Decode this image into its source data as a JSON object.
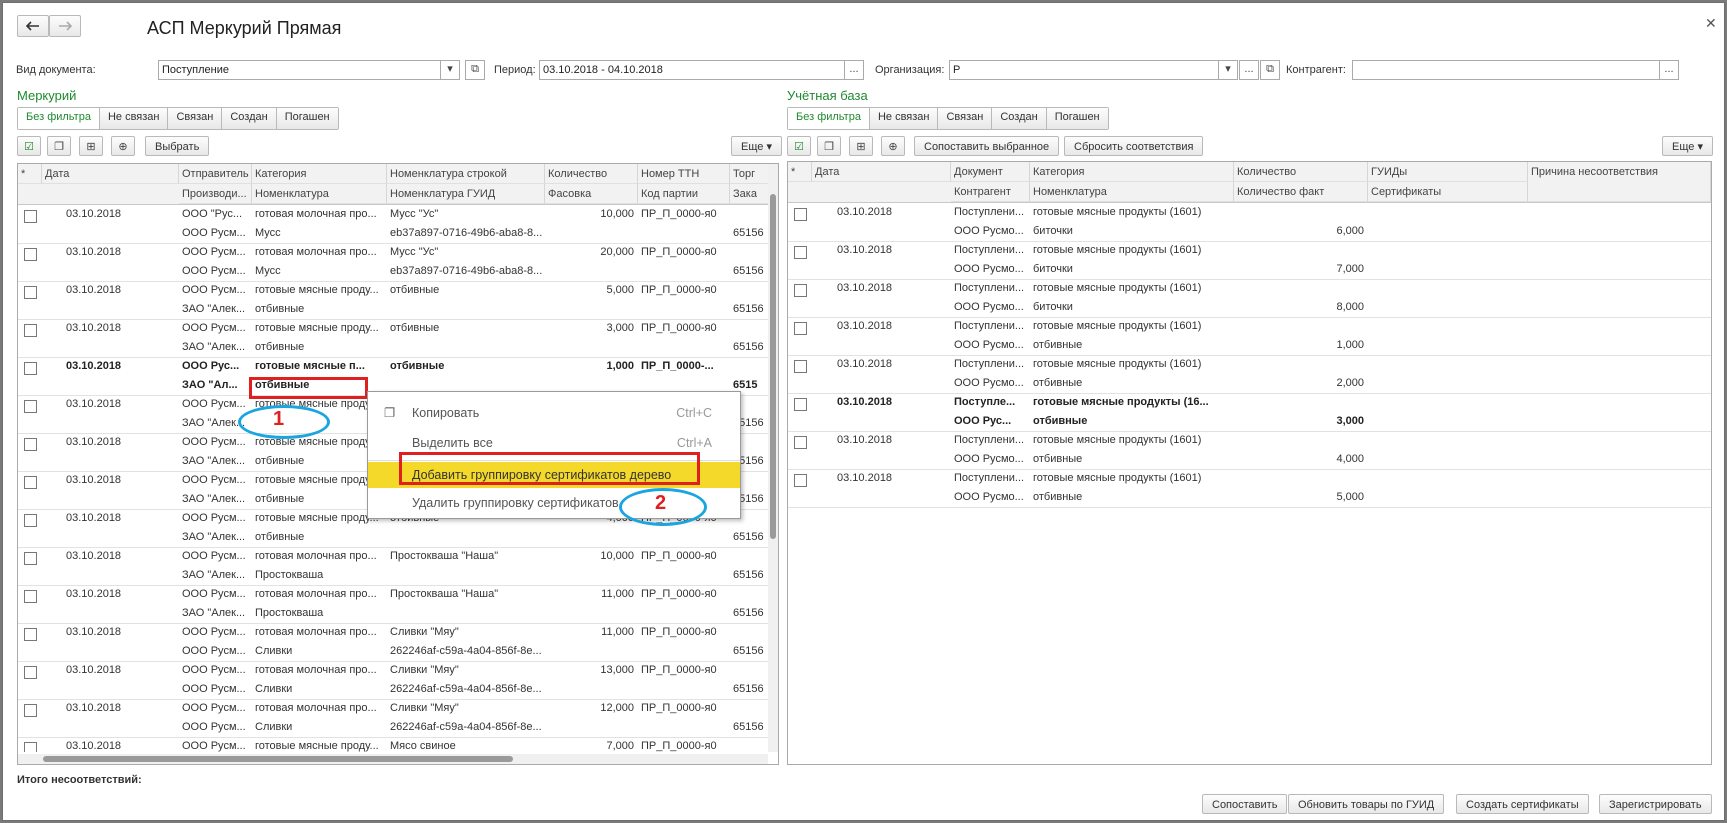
{
  "window": {
    "title": "АСП Меркурий Прямая"
  },
  "filters": {
    "doc_type_label": "Вид документа:",
    "doc_type_value": "Поступление",
    "period_label": "Период:",
    "period_value": "03.10.2018 - 04.10.2018",
    "org_label": "Организация:",
    "org_value": "Р",
    "contractor_label": "Контрагент:",
    "contractor_value": ""
  },
  "left": {
    "title": "Меркурий",
    "tabs": [
      "Без фильтра",
      "Не связан",
      "Связан",
      "Создан",
      "Погашен"
    ],
    "select_button": "Выбрать",
    "more_button": "Еще",
    "headers_top": [
      "Дата",
      "Отправитель",
      "Категория",
      "Номенклатура строкой",
      "Количество",
      "Номер ТТН",
      "Торг"
    ],
    "headers_bottom": [
      "Производи...",
      "Номенклатура",
      "Номенклатура ГУИД",
      "Фасовка",
      "Код партии",
      "Зака"
    ],
    "rows": [
      {
        "date": "03.10.2018",
        "sender": "ООО \"Рус...",
        "cat": "готовая молочная про...",
        "nom_str": "Мусс \"Ус\"",
        "qty": "10,000",
        "ttn": "ПР_П_0000-я0",
        "trade": "",
        "prod": "ООО Русм...",
        "nom": "Мусс",
        "guid": "eb37a897-0716-49b6-aba8-8...",
        "fas": "",
        "lot": "",
        "order": "65156"
      },
      {
        "date": "03.10.2018",
        "sender": "ООО Русм...",
        "cat": "готовая молочная про...",
        "nom_str": "Мусс \"Ус\"",
        "qty": "20,000",
        "ttn": "ПР_П_0000-я0",
        "trade": "",
        "prod": "ООО Русм...",
        "nom": "Мусс",
        "guid": "eb37a897-0716-49b6-aba8-8...",
        "fas": "",
        "lot": "",
        "order": "65156"
      },
      {
        "date": "03.10.2018",
        "sender": "ООО Русм...",
        "cat": "готовые мясные проду...",
        "nom_str": "отбивные",
        "qty": "5,000",
        "ttn": "ПР_П_0000-я0",
        "trade": "",
        "prod": "ЗАО \"Алек...",
        "nom": "отбивные",
        "guid": "",
        "fas": "",
        "lot": "",
        "order": "65156"
      },
      {
        "date": "03.10.2018",
        "sender": "ООО Русм...",
        "cat": "готовые мясные проду...",
        "nom_str": "отбивные",
        "qty": "3,000",
        "ttn": "ПР_П_0000-я0",
        "trade": "",
        "prod": "ЗАО \"Алек...",
        "nom": "отбивные",
        "guid": "",
        "fas": "",
        "lot": "",
        "order": "65156"
      },
      {
        "date": "03.10.2018",
        "sender": "ООО Рус...",
        "cat": "готовые мясные п...",
        "nom_str": "отбивные",
        "qty": "1,000",
        "ttn": "ПР_П_0000-...",
        "trade": "",
        "prod": "ЗАО \"Ал...",
        "nom": "отбивные",
        "guid": "",
        "fas": "",
        "lot": "",
        "order": "6515",
        "bold": true
      },
      {
        "date": "03.10.2018",
        "sender": "ООО Русм...",
        "cat": "готовые мясные проду...",
        "nom_str": "",
        "qty": "",
        "ttn": "",
        "trade": "",
        "prod": "ЗАО \"Алек...",
        "nom": "",
        "guid": "",
        "fas": "",
        "lot": "",
        "order": "65156"
      },
      {
        "date": "03.10.2018",
        "sender": "ООО Русм...",
        "cat": "готовые мясные проду...",
        "nom_str": "",
        "qty": "",
        "ttn": "",
        "trade": "",
        "prod": "ЗАО \"Алек...",
        "nom": "отбивные",
        "guid": "",
        "fas": "",
        "lot": "",
        "order": "65156"
      },
      {
        "date": "03.10.2018",
        "sender": "ООО Русм...",
        "cat": "готовые мясные проду...",
        "nom_str": "",
        "qty": "",
        "ttn": "",
        "trade": "",
        "prod": "ЗАО \"Алек...",
        "nom": "отбивные",
        "guid": "",
        "fas": "",
        "lot": "",
        "order": "65156"
      },
      {
        "date": "03.10.2018",
        "sender": "ООО Русм...",
        "cat": "готовые мясные проду...",
        "nom_str": "отбивные",
        "qty": "4,000",
        "ttn": "ПР_П_0000-я0",
        "trade": "",
        "prod": "ЗАО \"Алек...",
        "nom": "отбивные",
        "guid": "",
        "fas": "",
        "lot": "",
        "order": "65156"
      },
      {
        "date": "03.10.2018",
        "sender": "ООО Русм...",
        "cat": "готовая молочная про...",
        "nom_str": "Простокваша \"Наша\"",
        "qty": "10,000",
        "ttn": "ПР_П_0000-я0",
        "trade": "",
        "prod": "ЗАО \"Алек...",
        "nom": "Простокваша",
        "guid": "",
        "fas": "",
        "lot": "",
        "order": "65156"
      },
      {
        "date": "03.10.2018",
        "sender": "ООО Русм...",
        "cat": "готовая молочная про...",
        "nom_str": "Простокваша \"Наша\"",
        "qty": "11,000",
        "ttn": "ПР_П_0000-я0",
        "trade": "",
        "prod": "ЗАО \"Алек...",
        "nom": "Простокваша",
        "guid": "",
        "fas": "",
        "lot": "",
        "order": "65156"
      },
      {
        "date": "03.10.2018",
        "sender": "ООО Русм...",
        "cat": "готовая молочная про...",
        "nom_str": "Сливки \"Мяу\"",
        "qty": "11,000",
        "ttn": "ПР_П_0000-я0",
        "trade": "",
        "prod": "ООО Русм...",
        "nom": "Сливки",
        "guid": "262246af-c59a-4a04-856f-8e...",
        "fas": "",
        "lot": "",
        "order": "65156"
      },
      {
        "date": "03.10.2018",
        "sender": "ООО Русм...",
        "cat": "готовая молочная про...",
        "nom_str": "Сливки \"Мяу\"",
        "qty": "13,000",
        "ttn": "ПР_П_0000-я0",
        "trade": "",
        "prod": "ООО Русм...",
        "nom": "Сливки",
        "guid": "262246af-c59a-4a04-856f-8e...",
        "fas": "",
        "lot": "",
        "order": "65156"
      },
      {
        "date": "03.10.2018",
        "sender": "ООО Русм...",
        "cat": "готовая молочная про...",
        "nom_str": "Сливки \"Мяу\"",
        "qty": "12,000",
        "ttn": "ПР_П_0000-я0",
        "trade": "",
        "prod": "ООО Русм...",
        "nom": "Сливки",
        "guid": "262246af-c59a-4a04-856f-8e...",
        "fas": "",
        "lot": "",
        "order": "65156"
      },
      {
        "date": "03.10.2018",
        "sender": "ООО Русм...",
        "cat": "готовые мясные проду...",
        "nom_str": "Мясо свиное",
        "qty": "7,000",
        "ttn": "ПР_П_0000-я0",
        "trade": "",
        "prod": "",
        "nom": "",
        "guid": "",
        "fas": "",
        "lot": "",
        "order": ""
      }
    ]
  },
  "right": {
    "title": "Учётная база",
    "tabs": [
      "Без фильтра",
      "Не связан",
      "Связан",
      "Создан",
      "Погашен"
    ],
    "match_button": "Сопоставить выбранное",
    "reset_button": "Сбросить соответствия",
    "more_button": "Еще",
    "headers_top": [
      "Дата",
      "Документ",
      "Категория",
      "Количество",
      "ГУИДы",
      "Причина несоответствия"
    ],
    "headers_bottom": [
      "Контрагент",
      "Номенклатура",
      "Количество факт",
      "Сертификаты"
    ],
    "rows": [
      {
        "date": "03.10.2018",
        "doc": "Поступлени...",
        "cat": "готовые мясные продукты (1601)",
        "qty": "",
        "contr": "ООО Русмо...",
        "nom": "биточки",
        "fact": "6,000"
      },
      {
        "date": "03.10.2018",
        "doc": "Поступлени...",
        "cat": "готовые мясные продукты (1601)",
        "qty": "",
        "contr": "ООО Русмо...",
        "nom": "биточки",
        "fact": "7,000"
      },
      {
        "date": "03.10.2018",
        "doc": "Поступлени...",
        "cat": "готовые мясные продукты (1601)",
        "qty": "",
        "contr": "ООО Русмо...",
        "nom": "биточки",
        "fact": "8,000"
      },
      {
        "date": "03.10.2018",
        "doc": "Поступлени...",
        "cat": "готовые мясные продукты (1601)",
        "qty": "",
        "contr": "ООО Русмо...",
        "nom": "отбивные",
        "fact": "1,000"
      },
      {
        "date": "03.10.2018",
        "doc": "Поступлени...",
        "cat": "готовые мясные продукты (1601)",
        "qty": "",
        "contr": "ООО Русмо...",
        "nom": "отбивные",
        "fact": "2,000"
      },
      {
        "date": "03.10.2018",
        "doc": "Поступле...",
        "cat": "готовые мясные продукты (16...",
        "qty": "",
        "contr": "ООО Рус...",
        "nom": "отбивные",
        "fact": "3,000",
        "bold": true
      },
      {
        "date": "03.10.2018",
        "doc": "Поступлени...",
        "cat": "готовые мясные продукты (1601)",
        "qty": "",
        "contr": "ООО Русмо...",
        "nom": "отбивные",
        "fact": "4,000"
      },
      {
        "date": "03.10.2018",
        "doc": "Поступлени...",
        "cat": "готовые мясные продукты (1601)",
        "qty": "",
        "contr": "ООО Русмо...",
        "nom": "отбивные",
        "fact": "5,000"
      }
    ]
  },
  "context_menu": {
    "items": [
      {
        "label": "Копировать",
        "shortcut": "Ctrl+C"
      },
      {
        "label": "Выделить все",
        "shortcut": "Ctrl+A"
      },
      {
        "label": "Добавить группировку сертификатов дерево",
        "shortcut": ""
      },
      {
        "label": "Удалить группировку сертификатов",
        "shortcut": ""
      }
    ]
  },
  "annotations": {
    "marker1": "1",
    "marker2": "2"
  },
  "footer": {
    "mismatch_label": "Итого несоответствий:",
    "buttons": [
      "Сопоставить",
      "Обновить товары по ГУИД",
      "Создать сертификаты",
      "Зарегистрировать"
    ]
  },
  "colors": {
    "accent_green": "#1e8a2e",
    "menu_highlight": "#f5d92a",
    "annotation_red": "#e02020",
    "annotation_blue": "#1ba5e0"
  }
}
